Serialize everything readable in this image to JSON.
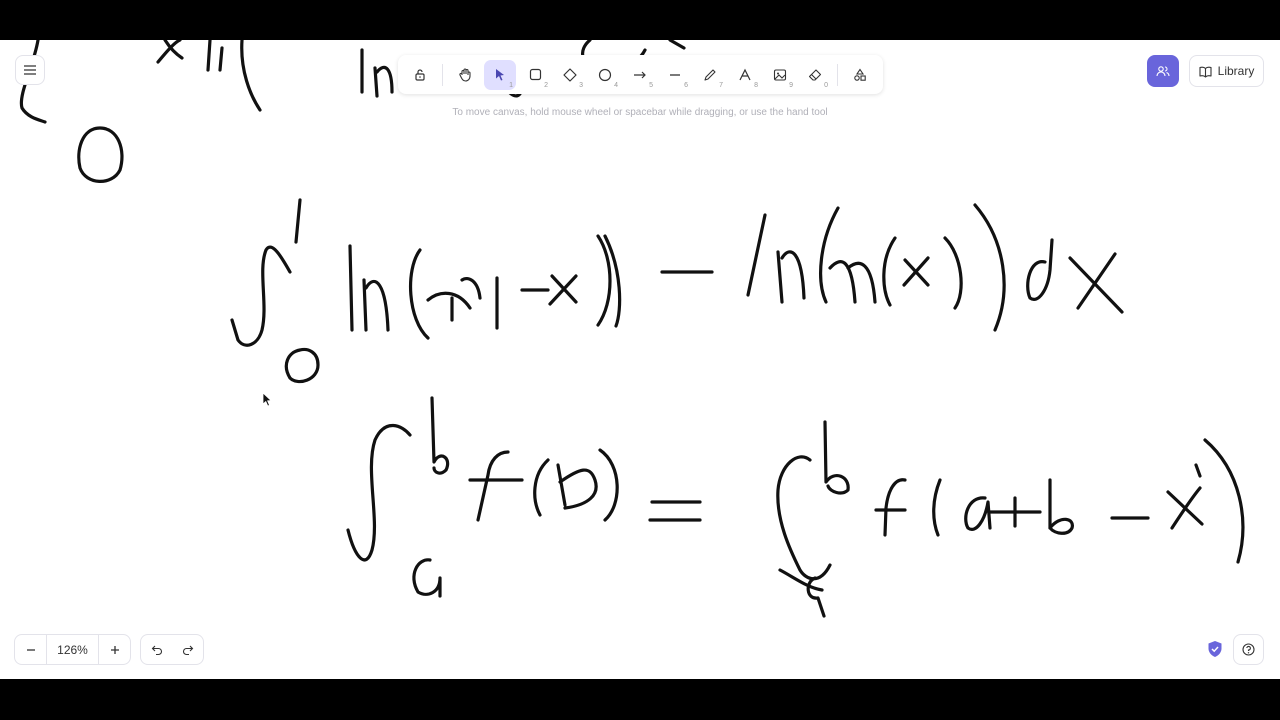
{
  "toolbar": {
    "tools": [
      {
        "name": "lock",
        "key": ""
      },
      {
        "name": "hand",
        "key": ""
      },
      {
        "name": "selection",
        "key": "1"
      },
      {
        "name": "rectangle",
        "key": "2"
      },
      {
        "name": "diamond",
        "key": "3"
      },
      {
        "name": "ellipse",
        "key": "4"
      },
      {
        "name": "arrow",
        "key": "5"
      },
      {
        "name": "line",
        "key": "6"
      },
      {
        "name": "draw",
        "key": "7"
      },
      {
        "name": "text",
        "key": "8"
      },
      {
        "name": "image",
        "key": "9"
      },
      {
        "name": "eraser",
        "key": "0"
      },
      {
        "name": "extra-tools",
        "key": ""
      }
    ],
    "active": "selection"
  },
  "hint": "To move canvas, hold mouse wheel or spacebar while dragging, or use the hand tool",
  "header": {
    "library_label": "Library"
  },
  "footer": {
    "zoom": "126%"
  },
  "colors": {
    "accent": "#6965db",
    "active_tool_bg": "#e0dfff"
  }
}
